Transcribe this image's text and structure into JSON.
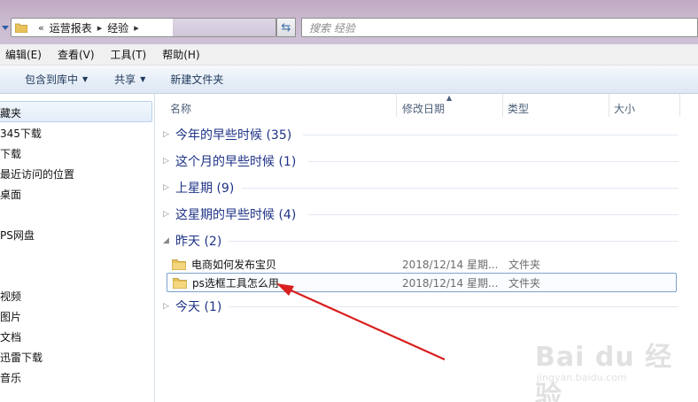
{
  "address": {
    "crumbs": [
      "运营报表",
      "经验"
    ],
    "overflow_glyph": "«",
    "separator_glyph": "▸"
  },
  "search": {
    "placeholder": "搜索 经验"
  },
  "menu": [
    "编辑(E)",
    "查看(V)",
    "工具(T)",
    "帮助(H)"
  ],
  "commands": {
    "include_library": "包含到库中",
    "share": "共享",
    "new_folder": "新建文件夹"
  },
  "nav": [
    "藏夹",
    "345下载",
    "下载",
    "最近访问的位置",
    "桌面",
    "PS网盘",
    "视频",
    "图片",
    "文档",
    "迅雷下载",
    "音乐"
  ],
  "columns": {
    "name": "名称",
    "date": "修改日期",
    "type": "类型",
    "size": "大小"
  },
  "groups": [
    {
      "label": "今年的早些时候 (35)",
      "expanded": false
    },
    {
      "label": "这个月的早些时候 (1)",
      "expanded": false
    },
    {
      "label": "上星期 (9)",
      "expanded": false
    },
    {
      "label": "这星期的早些时候 (4)",
      "expanded": false
    },
    {
      "label": "昨天 (2)",
      "expanded": true
    },
    {
      "label": "今天 (1)",
      "expanded": false
    }
  ],
  "files": [
    {
      "name": "电商如何发布宝贝",
      "date": "2018/12/14 星期...",
      "type": "文件夹"
    },
    {
      "name": "ps选框工具怎么用",
      "date": "2018/12/14 星期...",
      "type": "文件夹"
    }
  ],
  "watermark": {
    "main": "Bai du 经验",
    "sub": "jingyan.baidu.com"
  },
  "colors": {
    "accent": "#1e3287",
    "arrow": "#d9201f",
    "folder": "#e8c25a"
  }
}
